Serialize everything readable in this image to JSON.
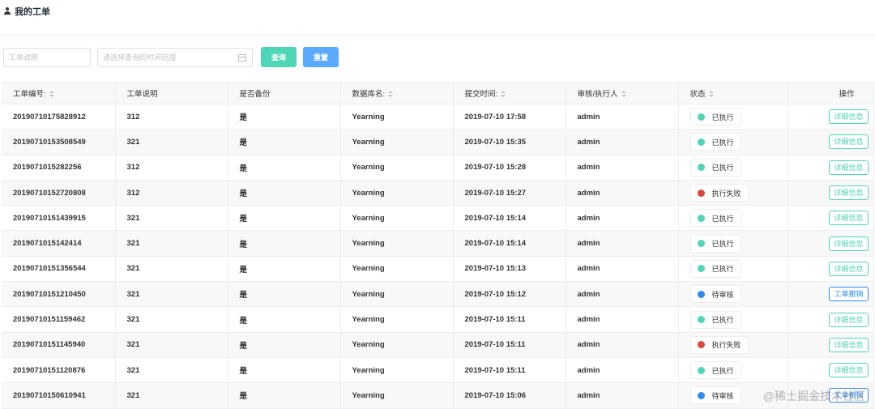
{
  "header": {
    "title": "我的工单",
    "icon": "user-icon"
  },
  "filters": {
    "description_placeholder": "工单说明",
    "time_range_placeholder": "请选择查询的时间范围",
    "query_label": "查询",
    "reset_label": "重置"
  },
  "colors": {
    "query_button": "#4ed6b6",
    "reset_button": "#5aabff",
    "executed": "#4ed6b6",
    "failed": "#e0463c",
    "pending": "#2d8cf0"
  },
  "table": {
    "headers": [
      "工单编号:",
      "工单说明",
      "是否备份",
      "数据库名:",
      "提交时间:",
      "审核/执行人",
      "状态",
      "操作"
    ],
    "rows": [
      {
        "id": "20190710175828912",
        "desc": "312",
        "backup": "是",
        "db": "Yearning",
        "time": "2019-07-10 17:58",
        "user": "admin",
        "status": "已执行",
        "status_type": "executed",
        "action": "详细信息"
      },
      {
        "id": "20190710153508549",
        "desc": "321",
        "backup": "是",
        "db": "Yearning",
        "time": "2019-07-10 15:35",
        "user": "admin",
        "status": "已执行",
        "status_type": "executed",
        "action": "详细信息"
      },
      {
        "id": "2019071015282256",
        "desc": "312",
        "backup": "是",
        "db": "Yearning",
        "time": "2019-07-10 15:28",
        "user": "admin",
        "status": "已执行",
        "status_type": "executed",
        "action": "详细信息"
      },
      {
        "id": "20190710152720808",
        "desc": "312",
        "backup": "是",
        "db": "Yearning",
        "time": "2019-07-10 15:27",
        "user": "admin",
        "status": "执行失败",
        "status_type": "failed",
        "action": "详细信息"
      },
      {
        "id": "20190710151439915",
        "desc": "321",
        "backup": "是",
        "db": "Yearning",
        "time": "2019-07-10 15:14",
        "user": "admin",
        "status": "已执行",
        "status_type": "executed",
        "action": "详细信息"
      },
      {
        "id": "2019071015142414",
        "desc": "321",
        "backup": "是",
        "db": "Yearning",
        "time": "2019-07-10 15:14",
        "user": "admin",
        "status": "已执行",
        "status_type": "executed",
        "action": "详细信息"
      },
      {
        "id": "20190710151356544",
        "desc": "321",
        "backup": "是",
        "db": "Yearning",
        "time": "2019-07-10 15:13",
        "user": "admin",
        "status": "已执行",
        "status_type": "executed",
        "action": "详细信息"
      },
      {
        "id": "20190710151210450",
        "desc": "321",
        "backup": "是",
        "db": "Yearning",
        "time": "2019-07-10 15:12",
        "user": "admin",
        "status": "待审核",
        "status_type": "pending",
        "action": "工单撤销"
      },
      {
        "id": "20190710151159462",
        "desc": "321",
        "backup": "是",
        "db": "Yearning",
        "time": "2019-07-10 15:11",
        "user": "admin",
        "status": "已执行",
        "status_type": "executed",
        "action": "详细信息"
      },
      {
        "id": "20190710151145940",
        "desc": "321",
        "backup": "是",
        "db": "Yearning",
        "time": "2019-07-10 15:11",
        "user": "admin",
        "status": "执行失败",
        "status_type": "failed",
        "action": "详细信息"
      },
      {
        "id": "20190710151120876",
        "desc": "321",
        "backup": "是",
        "db": "Yearning",
        "time": "2019-07-10 15:11",
        "user": "admin",
        "status": "已执行",
        "status_type": "executed",
        "action": "详细信息"
      },
      {
        "id": "20190710150610941",
        "desc": "321",
        "backup": "是",
        "db": "Yearning",
        "time": "2019-07-10 15:06",
        "user": "admin",
        "status": "待审核",
        "status_type": "pending",
        "action": "工单撤销"
      }
    ]
  },
  "watermark": "@稀土掘金技术社区"
}
